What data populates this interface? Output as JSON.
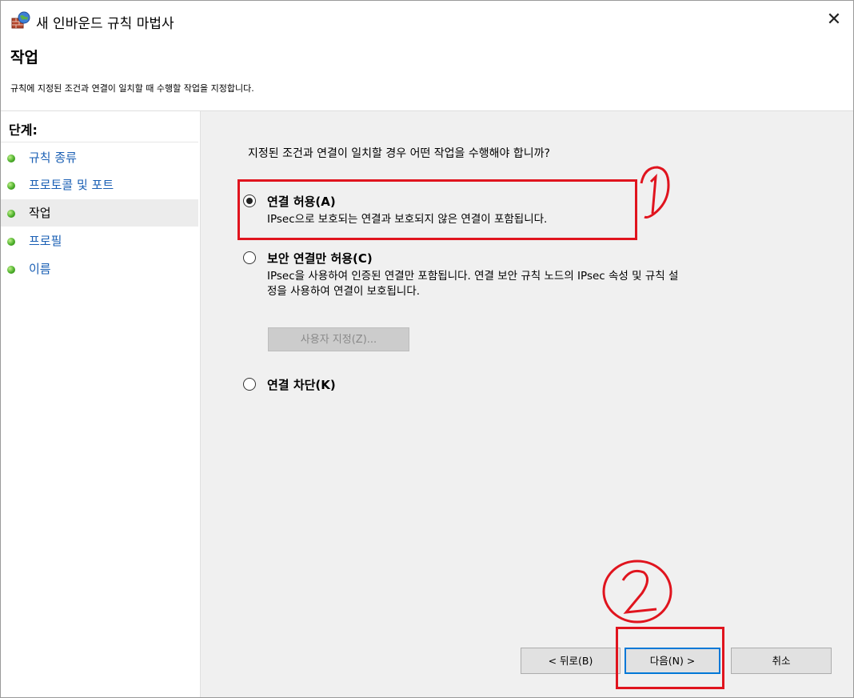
{
  "window": {
    "title": "새 인바운드 규칙 마법사",
    "close_glyph": "✕"
  },
  "header": {
    "heading": "작업",
    "subheading": "규칙에 지정된 조건과 연결이 일치할 때 수행할 작업을 지정합니다."
  },
  "steps": {
    "title": "단계:",
    "items": [
      {
        "label": "규칙 종류",
        "active": false
      },
      {
        "label": "프로토콜 및 포트",
        "active": false
      },
      {
        "label": "작업",
        "active": true
      },
      {
        "label": "프로필",
        "active": false
      },
      {
        "label": "이름",
        "active": false
      }
    ]
  },
  "main": {
    "question": "지정된 조건과 연결이 일치할 경우 어떤 작업을 수행해야 합니까?",
    "options": [
      {
        "label": "연결 허용(A)",
        "checked": true,
        "desc_lines": [
          "IPsec으로 보호되는 연결과 보호되지 않은 연결이 포함됩니다."
        ]
      },
      {
        "label": "보안 연결만 허용(C)",
        "checked": false,
        "desc_lines": [
          "IPsec을 사용하여 인증된 연결만 포함됩니다. 연결 보안 규칙 노드의 IPsec 속성 및 규칙 설",
          "정을 사용하여 연결이 보호됩니다."
        ]
      },
      {
        "label": "연결 차단(K)",
        "checked": false,
        "desc_lines": []
      }
    ],
    "customize_button": "사용자 지정(Z)..."
  },
  "footer": {
    "back_button": "< 뒤로(B)",
    "next_button": "다음(N) >",
    "cancel_button": "취소"
  },
  "annotations": {
    "color": "#e0141e",
    "mark_1": "1",
    "mark_2": "2"
  }
}
